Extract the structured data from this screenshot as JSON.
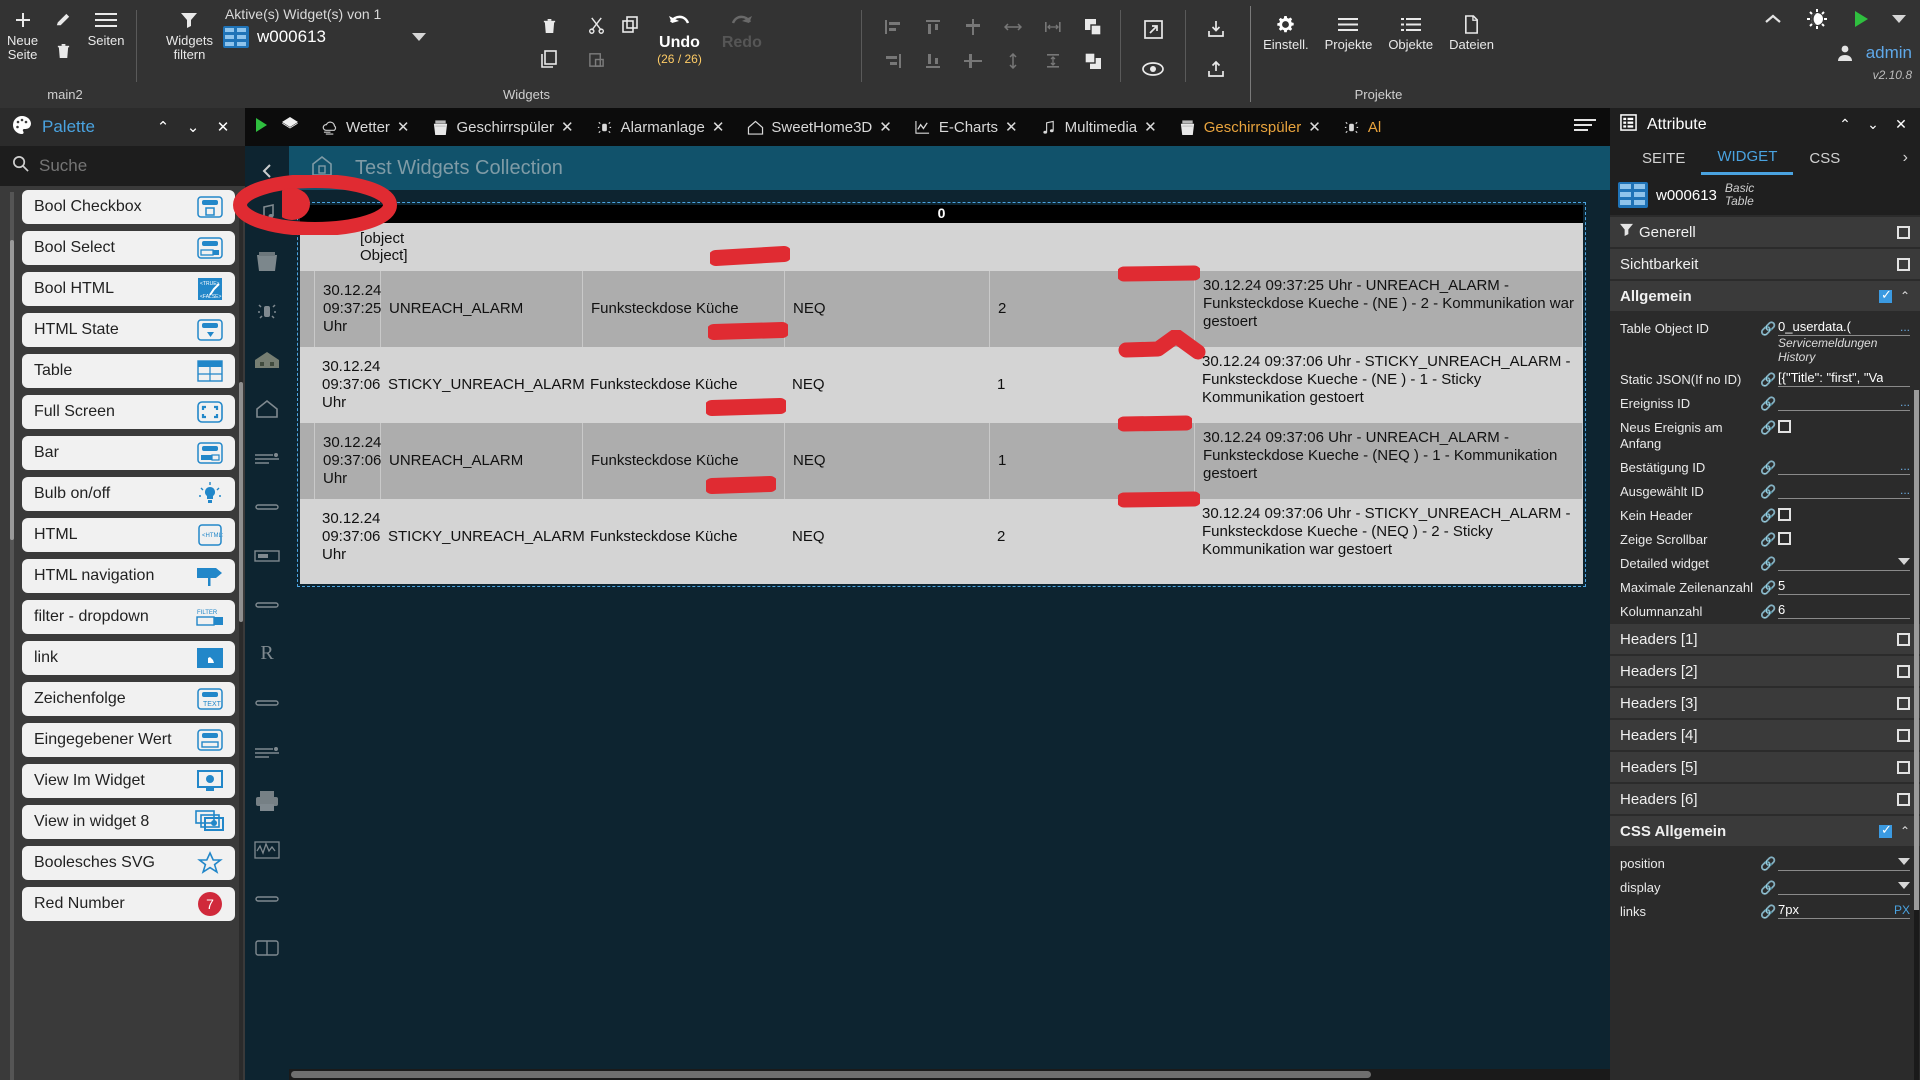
{
  "toolbar": {
    "page_group": {
      "new_page": "Neue\nSeite",
      "pages": "Seiten",
      "label": "main2",
      "new_page_line1": "Neue",
      "new_page_line2": "Seite"
    },
    "widgets_filter": "Widgets\nfiltern",
    "widgets_filter_l1": "Widgets",
    "widgets_filter_l2": "filtern",
    "active_widgets_caption": "Aktive(s) Widget(s) von 1",
    "active_widget_name": "w000613",
    "widgets_group_label": "Widgets",
    "undo_label": "Undo",
    "undo_count": "(26 / 26)",
    "redo_label": "Redo",
    "projects_group_label": "Projekte",
    "settings_label": "Einstell.",
    "projects_label": "Projekte",
    "objects_label": "Objekte",
    "files_label": "Dateien",
    "user": "admin",
    "version": "v2.10.8"
  },
  "palette": {
    "title": "Palette",
    "search_placeholder": "Suche",
    "items": [
      {
        "label": "Bool Checkbox",
        "icon": "checkbox-widget-icon"
      },
      {
        "label": "Bool Select",
        "icon": "select-widget-icon"
      },
      {
        "label": "Bool HTML",
        "icon": "bool-html-icon"
      },
      {
        "label": "HTML State",
        "icon": "html-state-icon"
      },
      {
        "label": "Table",
        "icon": "table-widget-icon"
      },
      {
        "label": "Full Screen",
        "icon": "fullscreen-icon"
      },
      {
        "label": "Bar",
        "icon": "bar-widget-icon"
      },
      {
        "label": "Bulb on/off",
        "icon": "bulb-icon"
      },
      {
        "label": "HTML",
        "icon": "html-icon"
      },
      {
        "label": "HTML navigation",
        "icon": "html-navigation-icon"
      },
      {
        "label": "filter - dropdown",
        "icon": "filter-dropdown-icon"
      },
      {
        "label": "link",
        "icon": "link-icon"
      },
      {
        "label": "Zeichenfolge",
        "icon": "text-widget-icon"
      },
      {
        "label": "Eingegebener Wert",
        "icon": "input-value-icon"
      },
      {
        "label": "View Im Widget",
        "icon": "view-in-widget-icon"
      },
      {
        "label": "View in widget 8",
        "icon": "view-in-widget8-icon"
      },
      {
        "label": "Boolesches SVG",
        "icon": "star-icon"
      },
      {
        "label": "Red Number",
        "icon": "red-number-badge",
        "badge": "7"
      }
    ]
  },
  "tabs": [
    {
      "label": "Wetter",
      "icon": "weather-icon",
      "active": false,
      "closable": true
    },
    {
      "label": "Geschirrspüler",
      "icon": "dishwasher-icon",
      "active": false,
      "closable": true
    },
    {
      "label": "Alarmanlage",
      "icon": "alarm-icon",
      "active": false,
      "closable": true
    },
    {
      "label": "SweetHome3D",
      "icon": "home-icon",
      "active": false,
      "closable": true
    },
    {
      "label": "E-Charts",
      "icon": "chart-icon",
      "active": false,
      "closable": true
    },
    {
      "label": "Multimedia",
      "icon": "music-icon",
      "active": false,
      "closable": true
    },
    {
      "label": "Geschirrspüler",
      "icon": "dishwasher-icon",
      "active": true,
      "closable": true
    },
    {
      "label": "Al",
      "icon": "alarm-icon",
      "active": true,
      "closable": false
    }
  ],
  "view": {
    "header_title": "Test Widgets Collection",
    "table_top_value": "0",
    "object_cell": "[object\nObject]",
    "object_cell_l1": "[object",
    "object_cell_l2": "Object]",
    "rows": [
      {
        "time": "30.12.24 09:37:25 Uhr",
        "alarm": "UNREACH_ALARM",
        "device": "Funksteckdose Küche",
        "neq": "NEQ",
        "count": "2",
        "message": "30.12.24 09:37:25 Uhr - UNREACH_ALARM - Funksteckdose Kueche - (NE          ) - 2 - Kommunikation war gestoert"
      },
      {
        "time": "30.12.24 09:37:06 Uhr",
        "alarm": "STICKY_UNREACH_ALARM",
        "device": "Funksteckdose Küche",
        "neq": "NEQ",
        "count": "1",
        "message": "30.12.24 09:37:06 Uhr - STICKY_UNREACH_ALARM - Funksteckdose Kueche - (NE        ) - 1 - Sticky Kommunikation gestoert"
      },
      {
        "time": "30.12.24 09:37:06 Uhr",
        "alarm": "UNREACH_ALARM",
        "device": "Funksteckdose Küche",
        "neq": "NEQ",
        "count": "1",
        "message": "30.12.24 09:37:06 Uhr - UNREACH_ALARM - Funksteckdose Kueche - (NEQ        ) - 1 - Kommunikation gestoert"
      },
      {
        "time": "30.12.24 09:37:06 Uhr",
        "alarm": "STICKY_UNREACH_ALARM",
        "device": "Funksteckdose Küche",
        "neq": "NEQ",
        "count": "2",
        "message": "30.12.24 09:37:06 Uhr - STICKY_UNREACH_ALARM - Funksteckdose Kueche - (NEQ        ) - 2 - Sticky Kommunikation war gestoert"
      }
    ]
  },
  "attributes": {
    "title": "Attribute",
    "tabs": [
      {
        "label": "SEITE",
        "active": false
      },
      {
        "label": "WIDGET",
        "active": true
      },
      {
        "label": "CSS",
        "active": false
      }
    ],
    "widget_name": "w000613",
    "widget_kind_l1": "Basic",
    "widget_kind_l2": "Table",
    "sections": [
      {
        "label": "Generell",
        "checked": false,
        "icon": "filter-icon"
      },
      {
        "label": "Sichtbarkeit",
        "checked": false
      },
      {
        "label": "Allgemein",
        "checked": true,
        "expanded": true,
        "bold": true
      }
    ],
    "allgemein_props": [
      {
        "label": "Table Object ID",
        "value": "0_userdata.(",
        "dots": "...",
        "sub": "Servicemeldungen History",
        "type": "text"
      },
      {
        "label": "Static JSON(If no ID)",
        "value": "[{\"Title\": \"first\", \"Va",
        "type": "text"
      },
      {
        "label": "Ereigniss ID",
        "value": "",
        "dots": "...",
        "type": "text"
      },
      {
        "label": "Neus Ereignis am Anfang",
        "value": "",
        "type": "checkbox",
        "checked": false
      },
      {
        "label": "Bestätigung ID",
        "value": "",
        "dots": "...",
        "type": "text"
      },
      {
        "label": "Ausgewählt ID",
        "value": "",
        "dots": "...",
        "type": "text"
      },
      {
        "label": "Kein Header",
        "value": "",
        "type": "checkbox",
        "checked": false
      },
      {
        "label": "Zeige Scrollbar",
        "value": "",
        "type": "checkbox",
        "checked": false
      },
      {
        "label": "Detailed widget",
        "value": "",
        "type": "select"
      },
      {
        "label": "Maximale Zeilenanzahl",
        "value": "5",
        "type": "text"
      },
      {
        "label": "Kolumnanzahl",
        "value": "6",
        "type": "text"
      }
    ],
    "header_sections": [
      {
        "label": "Headers [1]",
        "checked": false
      },
      {
        "label": "Headers [2]",
        "checked": false
      },
      {
        "label": "Headers [3]",
        "checked": false
      },
      {
        "label": "Headers [4]",
        "checked": false
      },
      {
        "label": "Headers [5]",
        "checked": false
      },
      {
        "label": "Headers [6]",
        "checked": false
      }
    ],
    "css_section": {
      "label": "CSS Allgemein",
      "checked": true
    },
    "css_props": [
      {
        "label": "position",
        "value": "",
        "type": "select"
      },
      {
        "label": "display",
        "value": "",
        "type": "select"
      },
      {
        "label": "links",
        "value": "7px",
        "unit": "PX",
        "type": "text"
      }
    ]
  },
  "colors": {
    "accent": "#4aa3e0",
    "tab_active": "#e8a33d",
    "canvas_bg": "#0d2430",
    "view_header": "#11526b",
    "annotation": "#e02b32",
    "run_green": "#2fbf3f",
    "badge_red": "#d0293b"
  }
}
